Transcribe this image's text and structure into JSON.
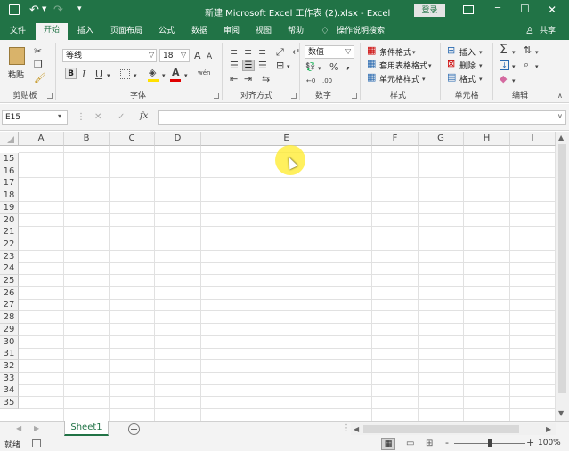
{
  "titlebar": {
    "title": "新建 Microsoft Excel 工作表 (2).xlsx  -  Excel",
    "login": "登录",
    "save_icon": "save-icon",
    "undo_icon": "undo-icon",
    "redo_icon": "redo-icon",
    "min": "─",
    "max": "☐",
    "close": "✕",
    "ribbon_display_icon": "ribbon-display-icon"
  },
  "tabs": [
    "文件",
    "开始",
    "插入",
    "页面布局",
    "公式",
    "数据",
    "审阅",
    "视图",
    "帮助"
  ],
  "active_tab": "开始",
  "tell_me": "操作说明搜索",
  "share": "共享",
  "ribbon": {
    "clipboard": {
      "paste": "粘贴",
      "group": "剪贴板"
    },
    "font": {
      "name": "等线",
      "size": "18",
      "group": "字体",
      "bold": "B",
      "italic": "I",
      "underline": "U",
      "grow": "A",
      "shrink": "A",
      "wen": "wén"
    },
    "alignment": {
      "group": "对齐方式"
    },
    "number": {
      "format": "数值",
      "group": "数字",
      "percent": "%",
      "comma": ","
    },
    "styles": {
      "conditional": "条件格式",
      "table": "套用表格格式",
      "cell": "单元格样式",
      "group": "样式"
    },
    "cells": {
      "insert": "插入",
      "delete": "删除",
      "format": "格式",
      "group": "单元格"
    },
    "editing": {
      "group": "编辑",
      "sum": "Σ"
    }
  },
  "formula": {
    "namebox": "E15",
    "fx": "fx",
    "cancel": "✕",
    "enter": "✓",
    "value": ""
  },
  "columns": [
    "A",
    "B",
    "C",
    "D",
    "E",
    "F",
    "G",
    "H",
    "I"
  ],
  "rows": [
    "15",
    "16",
    "17",
    "18",
    "19",
    "20",
    "21",
    "22",
    "23",
    "24",
    "25",
    "26",
    "27",
    "28",
    "29",
    "30",
    "31",
    "32",
    "33",
    "34",
    "35"
  ],
  "sheets": [
    "Sheet1"
  ],
  "status": {
    "ready": "就绪",
    "zoom": "100%",
    "minus": "-",
    "plus": "+"
  },
  "colors": {
    "brand": "#217346",
    "ribbon": "#f3f3f3",
    "pointer": "#ffe000"
  }
}
